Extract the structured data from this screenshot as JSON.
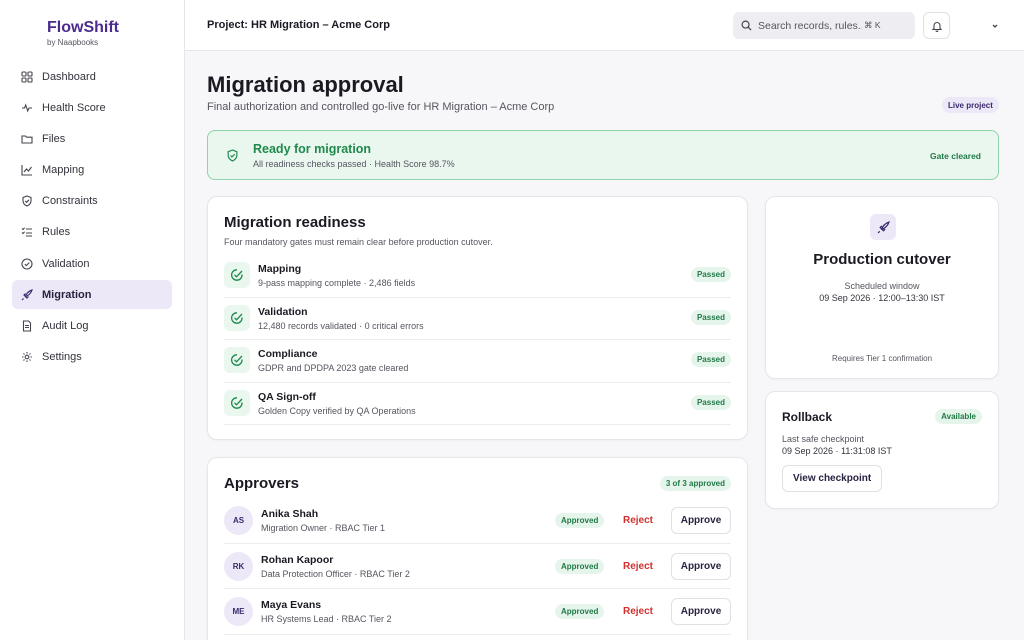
{
  "brand": {
    "name": "FlowShift",
    "sub": "by Naapbooks"
  },
  "nav": [
    {
      "id": "dashboard",
      "label": "Dashboard",
      "icon": "grid-icon",
      "active": false
    },
    {
      "id": "health-score",
      "label": "Health Score",
      "icon": "pulse-icon",
      "active": false
    },
    {
      "id": "files",
      "label": "Files",
      "icon": "folder-icon",
      "active": false
    },
    {
      "id": "mapping",
      "label": "Mapping",
      "icon": "chart-icon",
      "active": false
    },
    {
      "id": "constraints",
      "label": "Constraints",
      "icon": "shield-icon",
      "active": false
    },
    {
      "id": "rules",
      "label": "Rules",
      "icon": "checklist-icon",
      "active": false
    },
    {
      "id": "validation",
      "label": "Validation",
      "icon": "check-circle-icon",
      "active": false
    },
    {
      "id": "migration",
      "label": "Migration",
      "icon": "rocket-icon",
      "active": true
    },
    {
      "id": "audit-log",
      "label": "Audit Log",
      "icon": "document-icon",
      "active": false
    },
    {
      "id": "settings",
      "label": "Settings",
      "icon": "gear-icon",
      "active": false
    }
  ],
  "header": {
    "project": "Project: HR Migration – Acme Corp",
    "search_placeholder": "Search records, rules...",
    "search_shortcut": "⌘ K"
  },
  "page": {
    "title": "Migration approval",
    "subtitle": "Final authorization and controlled go-live for HR Migration – Acme Corp",
    "badge": "Live project"
  },
  "banner": {
    "title": "Ready for migration",
    "subtitle": "All readiness checks passed · Health Score 98.7%",
    "status": "Gate cleared"
  },
  "readiness": {
    "title": "Migration readiness",
    "subtitle": "Four mandatory gates must remain clear before production cutover.",
    "gates": [
      {
        "name": "Mapping",
        "desc": "9-pass mapping complete · 2,486 fields",
        "status": "Passed"
      },
      {
        "name": "Validation",
        "desc": "12,480 records validated · 0 critical errors",
        "status": "Passed"
      },
      {
        "name": "Compliance",
        "desc": "GDPR and DPDPA 2023 gate cleared",
        "status": "Passed"
      },
      {
        "name": "QA Sign-off",
        "desc": "Golden Copy verified by QA Operations",
        "status": "Passed"
      }
    ]
  },
  "cutover": {
    "title": "Production cutover",
    "window_label": "Scheduled window",
    "window_time": "09 Sep 2026 · 12:00–13:30 IST",
    "requirement": "Requires Tier 1 confirmation"
  },
  "rollback": {
    "title": "Rollback",
    "status": "Available",
    "checkpoint_label": "Last safe checkpoint",
    "checkpoint_time": "09 Sep 2026 · 11:31:08 IST",
    "button": "View checkpoint"
  },
  "approvers": {
    "title": "Approvers",
    "count": "3 of 3 approved",
    "reject_label": "Reject",
    "approve_label": "Approve",
    "list": [
      {
        "initials": "AS",
        "name": "Anika Shah",
        "role": "Migration Owner · RBAC Tier 1",
        "status": "Approved"
      },
      {
        "initials": "RK",
        "name": "Rohan Kapoor",
        "role": "Data Protection Officer · RBAC Tier 2",
        "status": "Approved"
      },
      {
        "initials": "ME",
        "name": "Maya Evans",
        "role": "HR Systems Lead · RBAC Tier 2",
        "status": "Approved"
      }
    ]
  },
  "colors": {
    "brand": "#4b2b8f",
    "accent_bg": "#ede8f8",
    "success": "#1f8a4c",
    "success_bg": "#eaf7ef",
    "danger": "#d32f2f"
  }
}
